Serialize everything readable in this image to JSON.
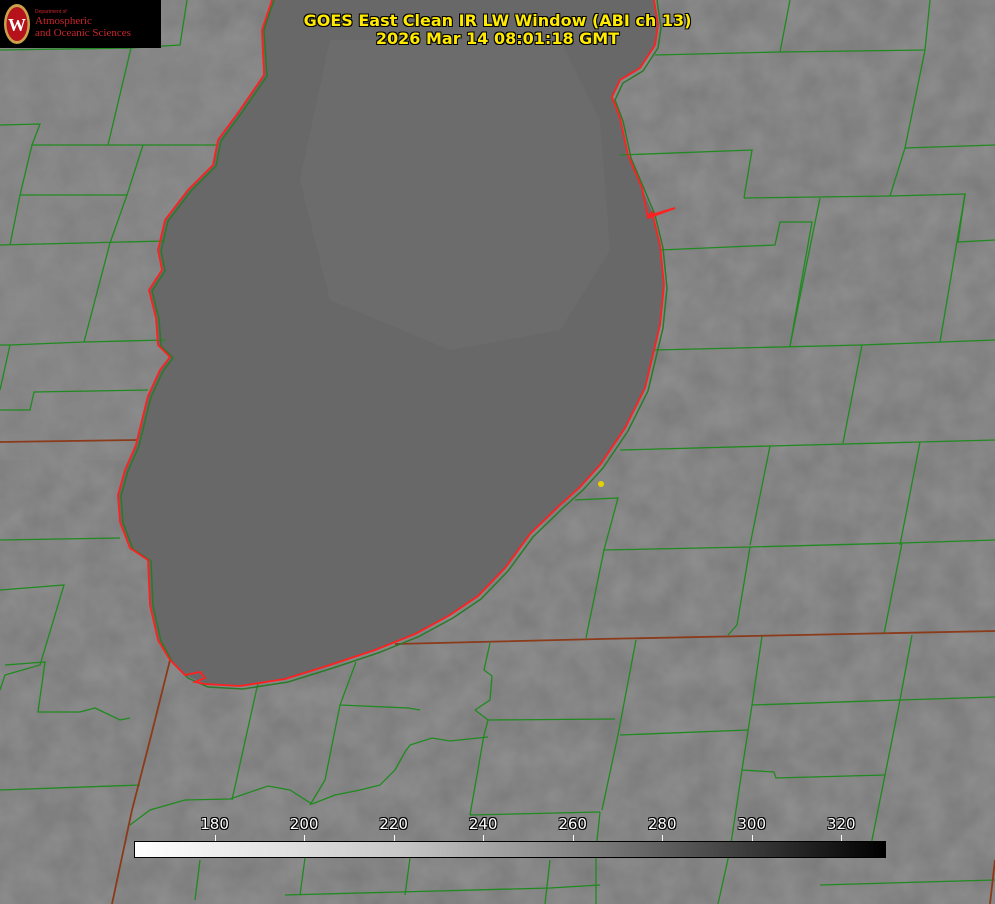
{
  "title": {
    "line1": "GOES East Clean IR LW Window (ABI ch 13)",
    "line2": "2026 Mar 14 08:01:18 GMT"
  },
  "logo": {
    "dept": "Department of",
    "line1": "Atmospheric",
    "line2": "and Oceanic Sciences",
    "seal_letter": "W"
  },
  "colorbar": {
    "min": 162,
    "max": 330,
    "tick_labels": [
      "180",
      "200",
      "220",
      "240",
      "260",
      "280",
      "300",
      "320"
    ]
  },
  "colors": {
    "coastline": "#ff2020",
    "county_borders": "#1f8a1f",
    "state_borders": "#8b3a1a",
    "marker": "#e6d200",
    "title_text": "#ffea00",
    "logo_red": "#c9262c"
  }
}
